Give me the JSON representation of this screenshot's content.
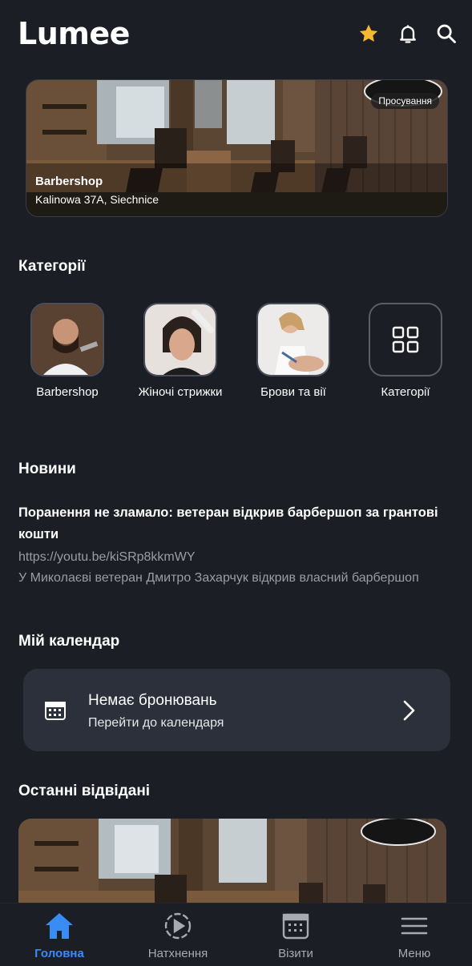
{
  "app": {
    "logo_text": "Lumee"
  },
  "header": {
    "icons": [
      "star-icon",
      "bell-icon",
      "search-icon"
    ],
    "accent_star": "#f5b82e"
  },
  "banner": {
    "title": "Barbershop",
    "address": "Kalinowa 37A, Siechnice",
    "badge": "Просування"
  },
  "categories": {
    "title": "Категорії",
    "items": [
      {
        "label": "Barbershop"
      },
      {
        "label": "Жіночі стрижки"
      },
      {
        "label": "Брови та вії"
      },
      {
        "label": "Категорії"
      }
    ]
  },
  "news": {
    "title": "Новини",
    "headline": "Поранення не зламало: ветеран відкрив барбершоп за грантові кошти",
    "link": "https://youtu.be/kiSRp8kkmWY",
    "excerpt": "У Миколаєві ветеран Дмитро Захарчук відкрив власний барбершоп"
  },
  "calendar": {
    "title": "Мій календар",
    "main_text": "Немає бронювань",
    "sub_text": "Перейти до календаря"
  },
  "recent": {
    "title": "Останні відвідані"
  },
  "bottom_nav": {
    "active_color": "#3a8cf5",
    "items": [
      {
        "label": "Головна",
        "icon": "home-icon",
        "active": true
      },
      {
        "label": "Натхнення",
        "icon": "play-circle-icon",
        "active": false
      },
      {
        "label": "Візити",
        "icon": "calendar-icon",
        "active": false
      },
      {
        "label": "Меню",
        "icon": "menu-icon",
        "active": false
      }
    ]
  }
}
